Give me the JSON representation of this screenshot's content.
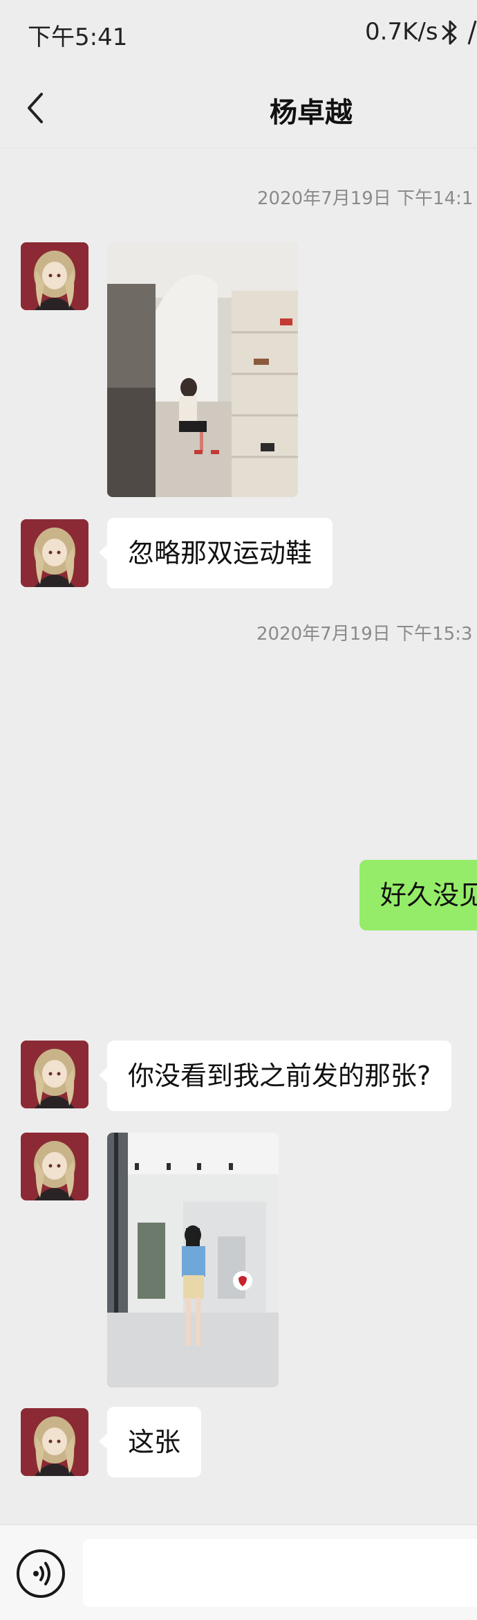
{
  "status_bar": {
    "time": "下午5:41",
    "network_speed": "0.7K/s",
    "bluetooth_icon": "bluetooth-icon"
  },
  "header": {
    "title": "杨卓越",
    "back_icon": "chevron-left-icon"
  },
  "messages": {
    "timestamp_1": "2020年7月19日 下午14:1",
    "image_1": "shoe-store-photo",
    "text_1": "忽略那双运动鞋",
    "timestamp_2": "2020年7月19日 下午15:3",
    "mine_text": "好久没见",
    "text_2": "你没看到我之前发的那张?",
    "image_2": "boutique-fitting-photo",
    "text_3": "这张"
  },
  "input_bar": {
    "voice_icon": "voice-icon",
    "placeholder": ""
  },
  "colors": {
    "background": "#ededed",
    "incoming_bubble": "#ffffff",
    "outgoing_bubble": "#95ec69",
    "avatar_bg": "#8b2a34"
  }
}
